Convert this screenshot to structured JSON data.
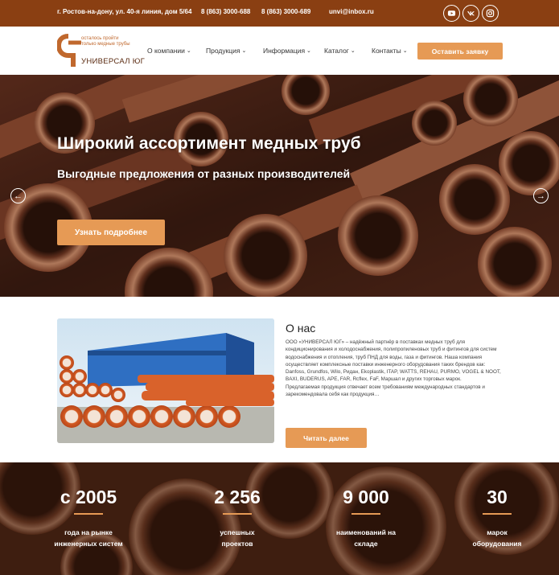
{
  "topbar": {
    "address": "г. Ростов-на-дону, ул. 40-я линия, дом 5/64",
    "phone1": "8 (863) 3000-688",
    "phone2": "8 (863) 3000-689",
    "email": "unvi@inbox.ru",
    "social": [
      "youtube-icon",
      "vk-icon",
      "instagram-icon"
    ]
  },
  "logo": {
    "slogan_line1": "осталось пройти",
    "slogan_line2": "только медные трубы",
    "brand": "УНИВЕРСАЛ ЮГ"
  },
  "nav": {
    "items": [
      {
        "label": "О компании"
      },
      {
        "label": "Продукция"
      },
      {
        "label": "Информация"
      },
      {
        "label": "Каталог"
      },
      {
        "label": "Контакты"
      }
    ],
    "cta_label": "Оставить заявку"
  },
  "hero": {
    "title": "Широкий ассортимент медных труб",
    "subtitle": "Выгодные предложения от разных производителей",
    "button_label": "Узнать подробнее",
    "prev_icon": "arrow-left-icon",
    "next_icon": "arrow-right-icon"
  },
  "about": {
    "title": "О нас",
    "paragraph1": "ООО «УНИВЕРСАЛ ЮГ» – надёжный партнёр в поставках медных труб для кондиционирования и холодоснабжения, полипропиленовых труб и фитингов для систем водоснабжения и отопления, труб ПНД для воды, газа и фитингов. Наша компания осуществляет комплексные поставки инженерного оборудования таких брендов как: Danfoss, Grundfos, Wilo, Ридан, Ekoplastik, ITAP, WATTS, REHAU, PURMO, VOGEL & NOOT, BAXI, BUDERUS, APE, FAR, Rcflex, FaF, Маршал и других торговых марок.",
    "paragraph2": "Предлагаемая продукция отвечает всем требованиям международных стандартов и зарекомендовала себя как продукция…",
    "button_label": "Читать далее"
  },
  "stats": [
    {
      "value": "с 2005",
      "label_line1": "года на рынке",
      "label_line2": "инженерных систем"
    },
    {
      "value": "2 256",
      "label_line1": "успешных",
      "label_line2": "проектов"
    },
    {
      "value": "9 000",
      "label_line1": "наименований на",
      "label_line2": "складе"
    },
    {
      "value": "30",
      "label_line1": "марок",
      "label_line2": "оборудования"
    }
  ],
  "colors": {
    "topbar": "#8a3f12",
    "accent": "#e69a55",
    "copper": "#b8673e"
  }
}
